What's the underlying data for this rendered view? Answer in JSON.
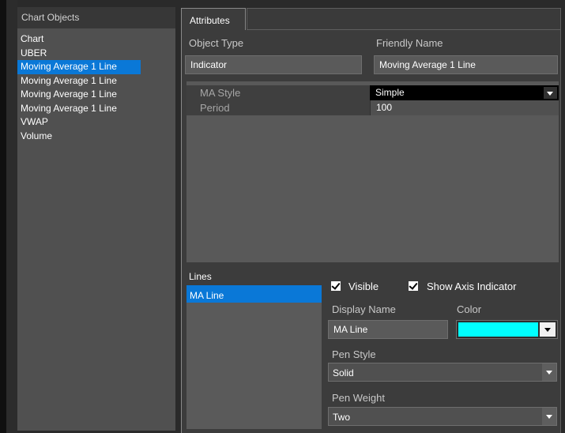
{
  "left_panel": {
    "header": "Chart Objects",
    "items": [
      {
        "label": "Chart"
      },
      {
        "label": "UBER"
      },
      {
        "label": "Moving Average 1 Line",
        "selected": true
      },
      {
        "label": "Moving Average 1 Line"
      },
      {
        "label": "Moving Average 1 Line"
      },
      {
        "label": "Moving Average 1 Line"
      },
      {
        "label": "VWAP"
      },
      {
        "label": "Volume"
      }
    ]
  },
  "tabs": [
    {
      "label": "Attributes",
      "active": true
    }
  ],
  "attributes": {
    "object_type_label": "Object Type",
    "object_type_value": "Indicator",
    "friendly_name_label": "Friendly Name",
    "friendly_name_value": "Moving Average 1 Line"
  },
  "params": {
    "ma_style_label": "MA Style",
    "ma_style_value": "Simple",
    "period_label": "Period",
    "period_value": "100"
  },
  "lines": {
    "header": "Lines",
    "items": [
      {
        "label": "MA Line",
        "selected": true
      }
    ],
    "visible_label": "Visible",
    "visible_checked": true,
    "show_axis_label": "Show Axis Indicator",
    "show_axis_checked": true,
    "display_name_label": "Display Name",
    "display_name_value": "MA Line",
    "color_label": "Color",
    "color_value": "#00ffff",
    "pen_style_label": "Pen Style",
    "pen_style_value": "Solid",
    "pen_weight_label": "Pen Weight",
    "pen_weight_value": "Two"
  },
  "icons": {
    "dropdown": "chevron-down-icon",
    "checkbox": "checkmark-icon"
  }
}
